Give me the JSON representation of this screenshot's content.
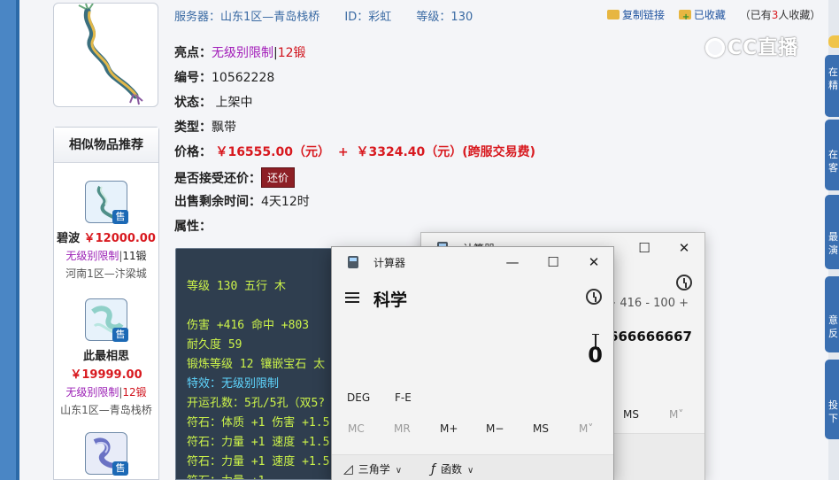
{
  "header": {
    "server": "服务器：山东1区—青岛栈桥",
    "id": "ID：彩虹",
    "level": "等级：130"
  },
  "actions": {
    "copy_link": "复制链接",
    "favorited": "已收藏",
    "fav_prefix": "（已有",
    "fav_count": "3",
    "fav_suffix": "人收藏）"
  },
  "details": {
    "highlight_label": "亮点：",
    "highlight_value": "无级别限制",
    "highlight_sep": "|",
    "highlight_forge": "12锻",
    "number_label": "编号：",
    "number_value": "10562228",
    "status_label": "状态：",
    "status_value": "上架中",
    "type_label": "类型：",
    "type_value": "飘带",
    "price_label": "价格：",
    "price_value": "￥16555.00（元）",
    "price_plus": "+",
    "price_fee": "￥3324.40（元）(跨服交易费)",
    "counter_label": "是否接受还价：",
    "counter_button": "还价",
    "time_label": "出售剩余时间：",
    "time_value": "4天12时",
    "attr_label": "属性："
  },
  "similar": {
    "title": "相似物品推荐",
    "sold_tag": "售",
    "items": [
      {
        "name": "碧波",
        "price": "￥12000.00",
        "limit": "无级别限制",
        "sep": "|",
        "forge": "11锻",
        "server": "河南1区—汴梁城"
      },
      {
        "name": "此最相思",
        "price": "￥19999.00",
        "limit": "无级别限制",
        "sep": "|",
        "forge": "12锻",
        "server": "山东1区—青岛栈桥"
      }
    ]
  },
  "attributes": {
    "l1": "等级 130 五行 木",
    "l2": "伤害 +416 命中 +803",
    "l3": "耐久度 59",
    "l4": "锻炼等级 12 镶嵌宝石 太",
    "l5": "特效：无级别限制",
    "l6": "开运孔数：5孔/5孔（双5?",
    "l7": "符石：体质 +1 伤害 +1.5",
    "l8": "符石：力量 +1 速度 +1.5",
    "l9": "符石：力量 +1 速度 +1.5",
    "l10": "符石：力量 +1"
  },
  "watermark": {
    "text": "CC直播"
  },
  "right_rail": {
    "t1": "在精",
    "t2": "在客",
    "t3": "最演",
    "t4": "意反",
    "t5": "投下"
  },
  "calc_back": {
    "title": "计算器",
    "expr": "+ 416 - 100 +",
    "value": "6666666667",
    "ms": "MS",
    "mv": "M˅"
  },
  "calc_front": {
    "title": "计算器",
    "mode": "科学",
    "display": "0",
    "deg": "DEG",
    "fe": "F-E",
    "mc": "MC",
    "mr": "MR",
    "mplus": "M+",
    "mminus": "M−",
    "ms": "MS",
    "mv": "M˅",
    "trig": "三角学",
    "func": "函数",
    "minimize": "—",
    "maximize": "☐",
    "close": "✕"
  }
}
